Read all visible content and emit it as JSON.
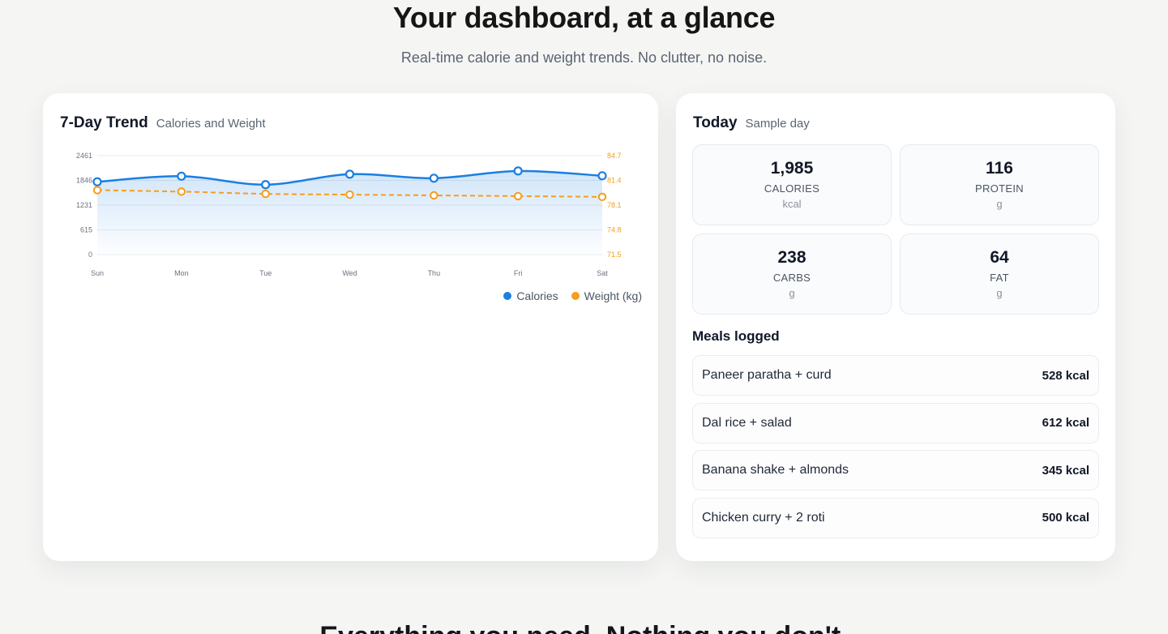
{
  "hero": {
    "title": "Your dashboard, at a glance",
    "subtitle": "Real-time calorie and weight trends. No clutter, no noise."
  },
  "trend_card": {
    "title": "7-Day Trend",
    "subtitle": "Calories and Weight"
  },
  "chart_data": {
    "type": "line",
    "categories": [
      "Sun",
      "Mon",
      "Tue",
      "Wed",
      "Thu",
      "Fri",
      "Sat"
    ],
    "series": [
      {
        "name": "Calories",
        "axis": "left",
        "values": [
          1810,
          1950,
          1740,
          2000,
          1900,
          2080,
          1960
        ],
        "color": "#1b7fe0"
      },
      {
        "name": "Weight (kg)",
        "axis": "right",
        "values": [
          80.1,
          79.9,
          79.6,
          79.5,
          79.4,
          79.3,
          79.2
        ],
        "color": "#f59e1c"
      }
    ],
    "y_left": {
      "min": 0,
      "max": 2461,
      "ticks": [
        "0",
        "615",
        "1231",
        "1846",
        "2461"
      ]
    },
    "y_right": {
      "min": 71.5,
      "max": 84.7,
      "ticks": [
        "71.5",
        "74.8",
        "78.1",
        "81.4",
        "84.7"
      ]
    },
    "grid": true,
    "legend": "bottom-right"
  },
  "today_card": {
    "title": "Today",
    "subtitle": "Sample day",
    "stats": [
      {
        "value": "1,985",
        "label": "CALORIES",
        "unit": "kcal"
      },
      {
        "value": "116",
        "label": "PROTEIN",
        "unit": "g"
      },
      {
        "value": "238",
        "label": "CARBS",
        "unit": "g"
      },
      {
        "value": "64",
        "label": "FAT",
        "unit": "g"
      }
    ],
    "meals_title": "Meals logged",
    "meals": [
      {
        "name": "Paneer paratha + curd",
        "kcal": "528 kcal"
      },
      {
        "name": "Dal rice + salad",
        "kcal": "612 kcal"
      },
      {
        "name": "Banana shake + almonds",
        "kcal": "345 kcal"
      },
      {
        "name": "Chicken curry + 2 roti",
        "kcal": "500 kcal"
      }
    ]
  },
  "footer": {
    "title": "Everything you need. Nothing you don't."
  }
}
